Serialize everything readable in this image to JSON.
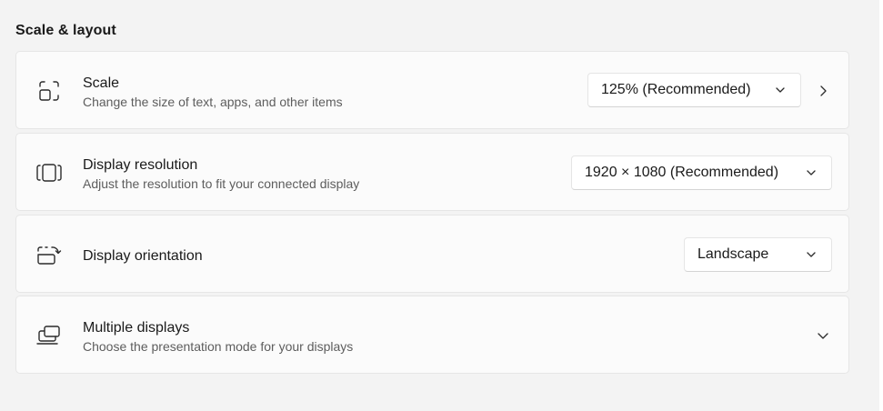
{
  "section": {
    "title": "Scale & layout"
  },
  "cards": {
    "scale": {
      "title": "Scale",
      "subtitle": "Change the size of text, apps, and other items",
      "value": "125% (Recommended)",
      "icon": "scale-icon"
    },
    "resolution": {
      "title": "Display resolution",
      "subtitle": "Adjust the resolution to fit your connected display",
      "value": "1920 × 1080 (Recommended)",
      "icon": "resolution-icon"
    },
    "orientation": {
      "title": "Display orientation",
      "value": "Landscape",
      "icon": "orientation-icon"
    },
    "multiple": {
      "title": "Multiple displays",
      "subtitle": "Choose the presentation mode for your displays",
      "icon": "multiple-displays-icon"
    }
  },
  "colors": {
    "background": "#f3f3f3",
    "card": "#fbfbfb",
    "text": "#1a1a1a",
    "subtext": "#5d5d5d"
  }
}
